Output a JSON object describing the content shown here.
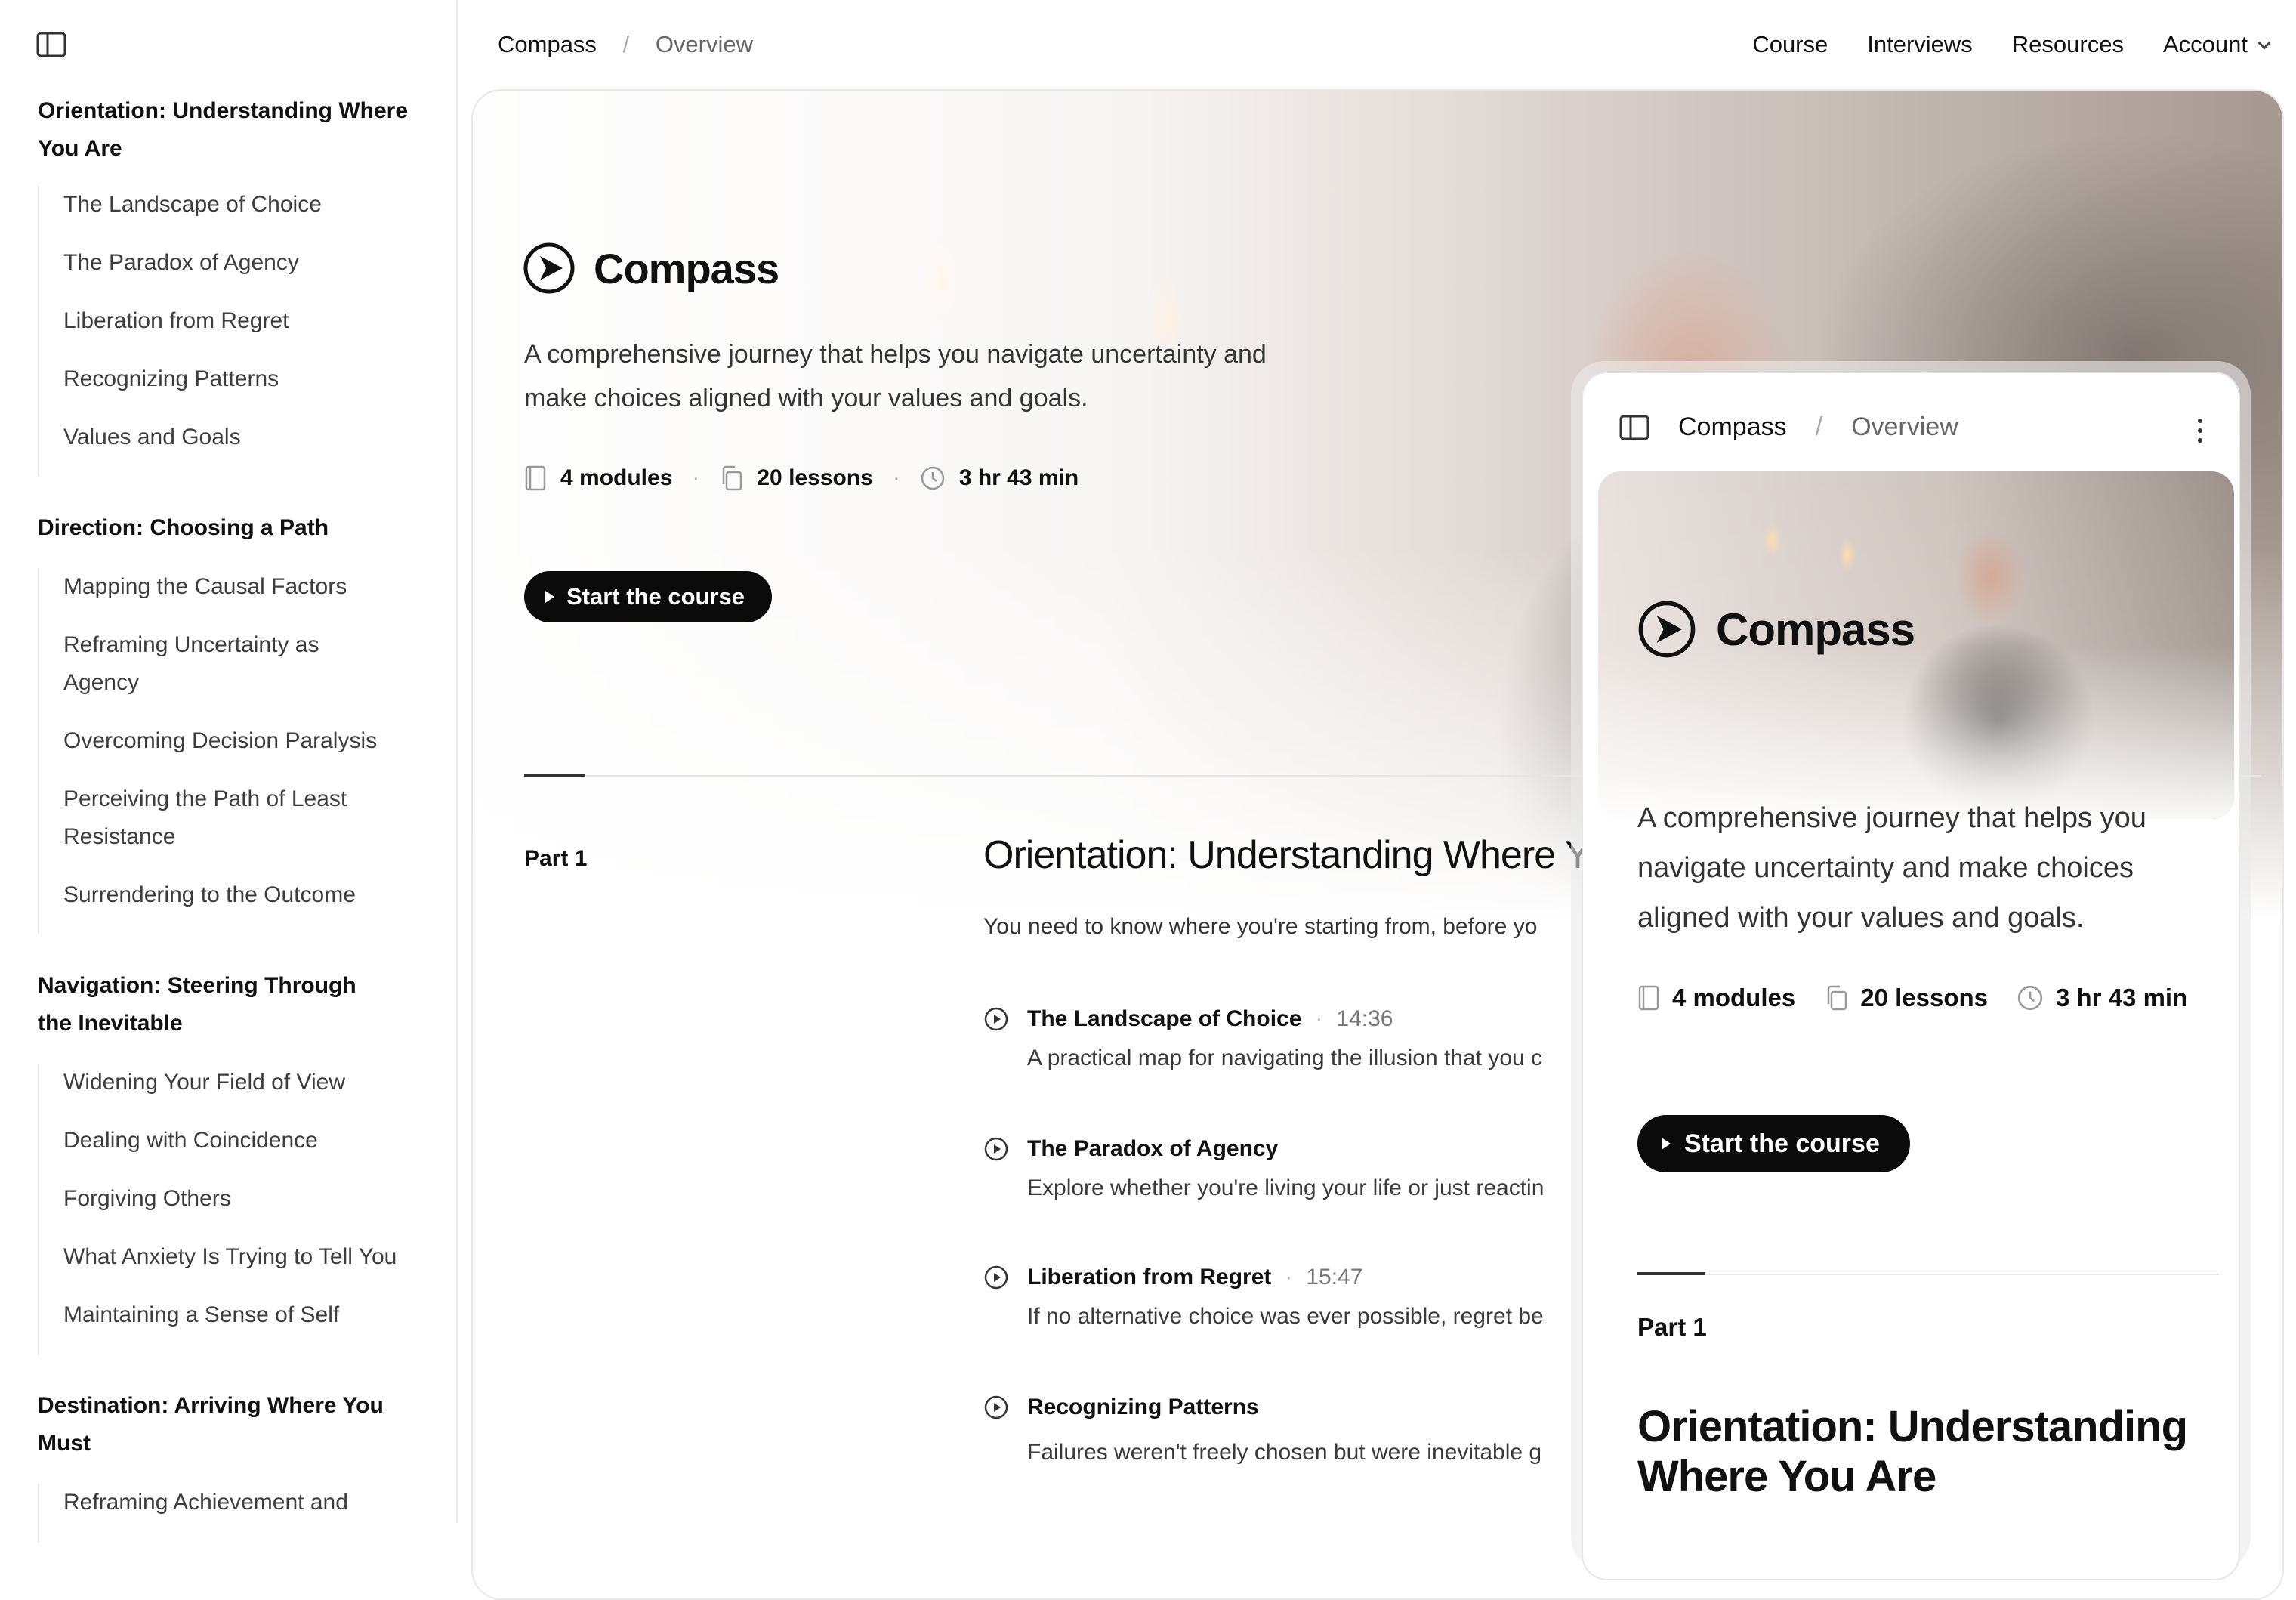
{
  "sidebar": {
    "modules": [
      {
        "title": "Orientation: Understanding Where You Are",
        "lessons": [
          "The Landscape of Choice",
          "The Paradox of Agency",
          "Liberation from Regret",
          "Recognizing Patterns",
          "Values and Goals"
        ]
      },
      {
        "title": "Direction: Choosing a Path",
        "lessons": [
          "Mapping the Causal Factors",
          "Reframing Uncertainty as Agency",
          "Overcoming Decision Paralysis",
          "Perceiving the Path of Least Resistance",
          "Surrendering to the Outcome"
        ]
      },
      {
        "title": "Navigation: Steering Through the Inevitable",
        "lessons": [
          "Widening Your Field of View",
          "Dealing with Coincidence",
          "Forgiving Others",
          "What Anxiety Is Trying to Tell You",
          "Maintaining a Sense of Self"
        ]
      },
      {
        "title": "Destination: Arriving Where You Must",
        "lessons": [
          "Reframing Achievement and"
        ]
      }
    ]
  },
  "breadcrumb": {
    "root": "Compass",
    "separator": "/",
    "current": "Overview"
  },
  "nav": {
    "course": "Course",
    "interviews": "Interviews",
    "resources": "Resources",
    "account": "Account"
  },
  "hero": {
    "title": "Compass",
    "description": "A comprehensive journey that helps you navigate uncertainty and make choices aligned with your values and goals.",
    "stats": {
      "modules": "4 modules",
      "lessons": "20 lessons",
      "duration": "3 hr 43 min"
    },
    "cta": "Start the course"
  },
  "part": {
    "label": "Part 1",
    "title": "Orientation: Understanding Where You Are",
    "description": "You need to know where you're starting from, before yo",
    "lessons": [
      {
        "title": "The Landscape of Choice",
        "duration": "14:36",
        "description": "A practical map for navigating the illusion that you c"
      },
      {
        "title": "The Paradox of Agency",
        "duration": "",
        "description": "Explore whether you're living your life or just reactin"
      },
      {
        "title": "Liberation from Regret",
        "duration": "15:47",
        "description": "If no alternative choice was ever possible, regret be"
      },
      {
        "title": "Recognizing Patterns",
        "duration": "",
        "description": "Failures weren't freely chosen but were inevitable g"
      }
    ]
  },
  "mobile": {
    "breadcrumb": {
      "root": "Compass",
      "separator": "/",
      "current": "Overview"
    },
    "title": "Compass",
    "description": "A comprehensive journey that helps you navigate uncertainty and make choices aligned with your values and goals.",
    "stats": {
      "modules": "4 modules",
      "lessons": "20 lessons",
      "duration": "3 hr 43 min"
    },
    "cta": "Start the course",
    "part_label": "Part 1",
    "part_title": "Orientation: Understanding Where You Are"
  },
  "icons": {
    "sidebar_toggle": "sidebar-toggle-icon",
    "brand": "play-compass-icon",
    "modules": "book-icon",
    "lessons": "copy-icon",
    "duration": "clock-icon",
    "lesson_play": "play-circle-icon",
    "menu": "kebab-icon"
  },
  "colors": {
    "cta_bg": "#0b0b0b",
    "text": "#111111",
    "muted": "#666666"
  }
}
